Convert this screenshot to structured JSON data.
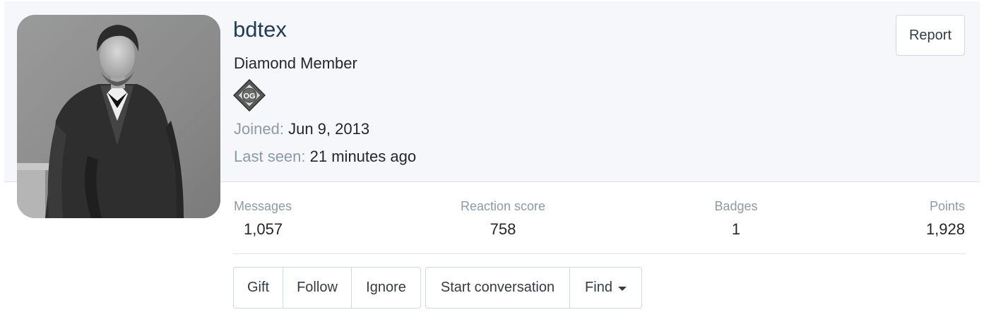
{
  "profile": {
    "username": "bdtex",
    "user_title": "Diamond Member",
    "badge_icon": "og-diamond-badge-icon",
    "badge_text": "OG",
    "avatar_icon": "portrait-photo-avatar",
    "joined_label": "Joined:",
    "joined_value": "Jun 9, 2013",
    "last_seen_label": "Last seen:",
    "last_seen_value": "21 minutes ago",
    "report_label": "Report"
  },
  "stats": [
    {
      "label": "Messages",
      "value": "1,057"
    },
    {
      "label": "Reaction score",
      "value": "758"
    },
    {
      "label": "Badges",
      "value": "1"
    },
    {
      "label": "Points",
      "value": "1,928"
    }
  ],
  "actions": {
    "gift": "Gift",
    "follow": "Follow",
    "ignore": "Ignore",
    "start_conversation": "Start conversation",
    "find": "Find"
  },
  "colors": {
    "username": "#1f3b5c",
    "muted_label": "#8a9aa8",
    "header_band": "#f5f7fa",
    "border": "#d3d8de"
  }
}
